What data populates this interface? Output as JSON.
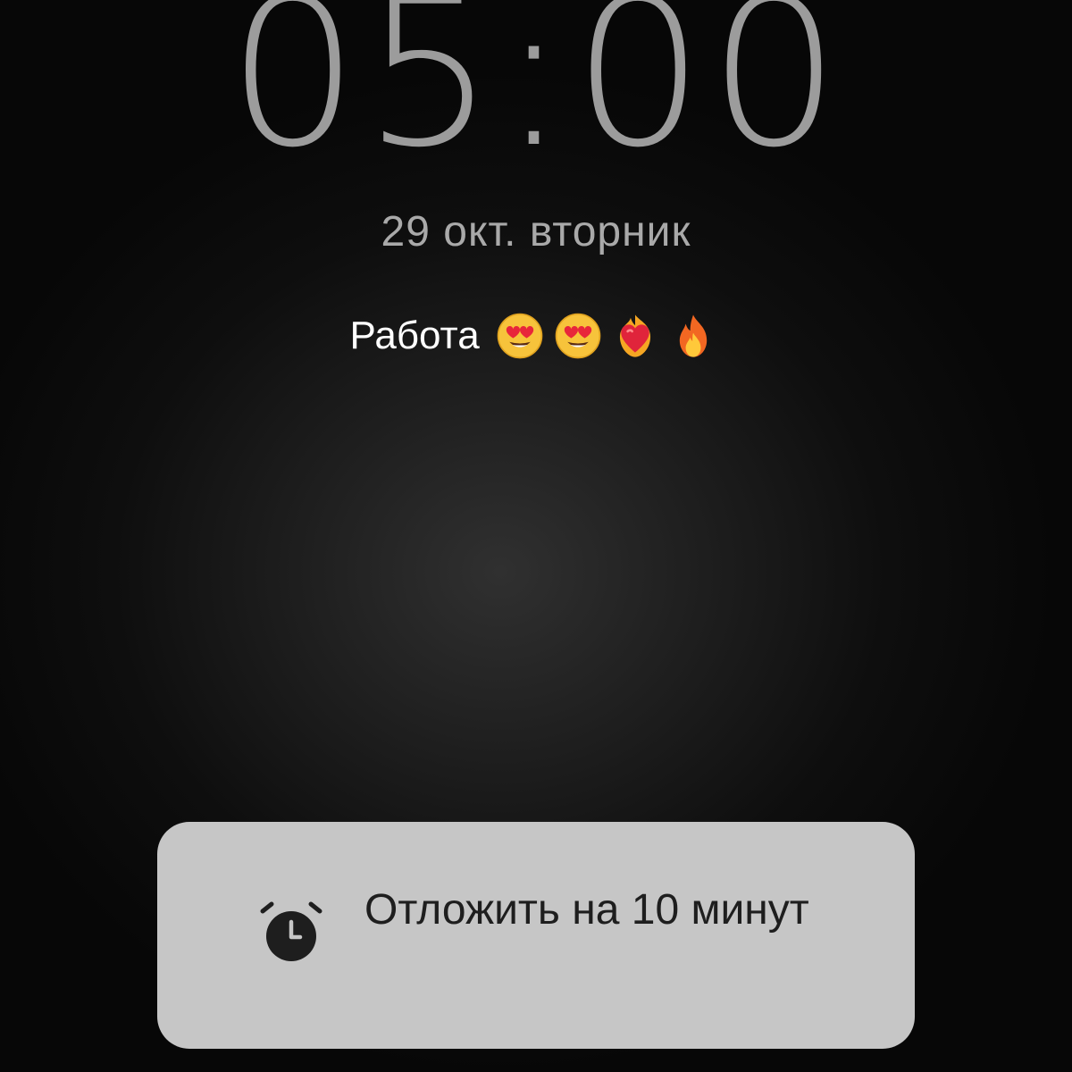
{
  "alarm": {
    "time": "05:00",
    "date": "29 окт. вторник",
    "label": "Работа",
    "label_emojis": [
      "smiling-face-heart-eyes-icon",
      "smiling-face-heart-eyes-icon",
      "heart-on-fire-icon",
      "fire-icon"
    ]
  },
  "snooze": {
    "label": "Отложить на 10 минут",
    "icon": "alarm-clock-icon"
  },
  "colors": {
    "clock_text": "#9c9c9c",
    "snooze_bg": "#c6c6c6",
    "snooze_text": "#1e1e1e"
  }
}
